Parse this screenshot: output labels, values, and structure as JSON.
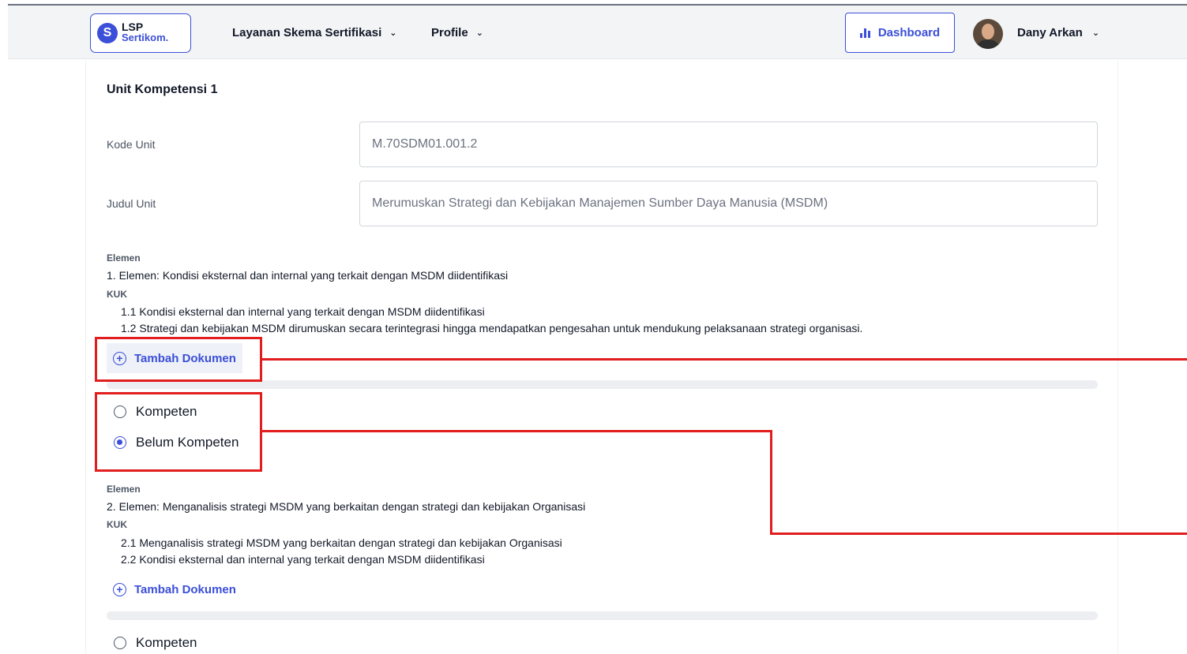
{
  "header": {
    "logo_top": "LSP",
    "logo_bottom": "Sertikom.",
    "logo_mark": "S",
    "nav": [
      {
        "label": "Layanan Skema Sertifikasi"
      },
      {
        "label": "Profile"
      }
    ],
    "dashboard_label": "Dashboard",
    "user_name": "Dany Arkan"
  },
  "unit": {
    "title": "Unit Kompetensi 1",
    "kode_label": "Kode Unit",
    "kode_value": "M.70SDM01.001.2",
    "judul_label": "Judul Unit",
    "judul_value": "Merumuskan Strategi dan Kebijakan Manajemen Sumber Daya Manusia (MSDM)"
  },
  "elements": [
    {
      "heading": "Elemen",
      "text": "1.  Elemen: Kondisi eksternal dan internal yang terkait dengan MSDM diidentifikasi",
      "kuk_heading": "KUK",
      "kuk": [
        "1.1  Kondisi eksternal dan internal yang terkait dengan MSDM diidentifikasi",
        "1.2  Strategi dan kebijakan MSDM dirumuskan secara terintegrasi hingga mendapatkan pengesahan untuk mendukung pelaksanaan strategi organisasi."
      ],
      "add_doc": "Tambah Dokumen",
      "radio_kompeten": "Kompeten",
      "radio_belum": "Belum Kompeten",
      "selected": "Belum Kompeten"
    },
    {
      "heading": "Elemen",
      "text": "2.  Elemen: Menganalisis strategi MSDM yang berkaitan dengan strategi dan kebijakan Organisasi",
      "kuk_heading": "KUK",
      "kuk": [
        "2.1  Menganalisis strategi MSDM yang berkaitan dengan strategi dan kebijakan Organisasi",
        "2.2  Kondisi eksternal dan internal yang terkait dengan MSDM diidentifikasi"
      ],
      "add_doc": "Tambah Dokumen",
      "radio_kompeten": "Kompeten"
    }
  ],
  "colors": {
    "accent": "#3b4fd8",
    "annotation": "#e11d1d"
  }
}
